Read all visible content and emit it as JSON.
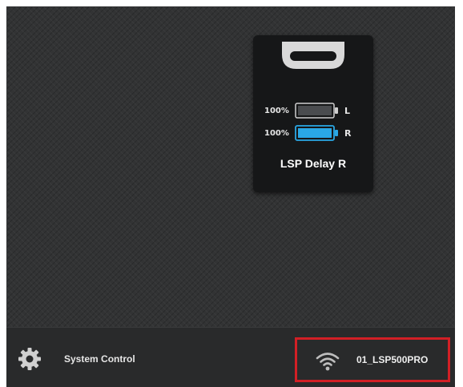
{
  "device": {
    "name": "LSP Delay R",
    "batteries": [
      {
        "percent": "100%",
        "side": "L",
        "level": 1.0,
        "active": false
      },
      {
        "percent": "100%",
        "side": "R",
        "level": 1.0,
        "active": true
      }
    ],
    "icons": {
      "handle": "speaker-handle-icon"
    }
  },
  "bottom_bar": {
    "system_control_label": "System Control",
    "network_name": "01_LSP500PRO",
    "icons": {
      "settings": "gear-icon",
      "wifi": "wifi-icon"
    }
  },
  "colors": {
    "background": "#323334",
    "card": "#161718",
    "active_battery": "#2aa8e6",
    "highlight_border": "#d21f25"
  }
}
